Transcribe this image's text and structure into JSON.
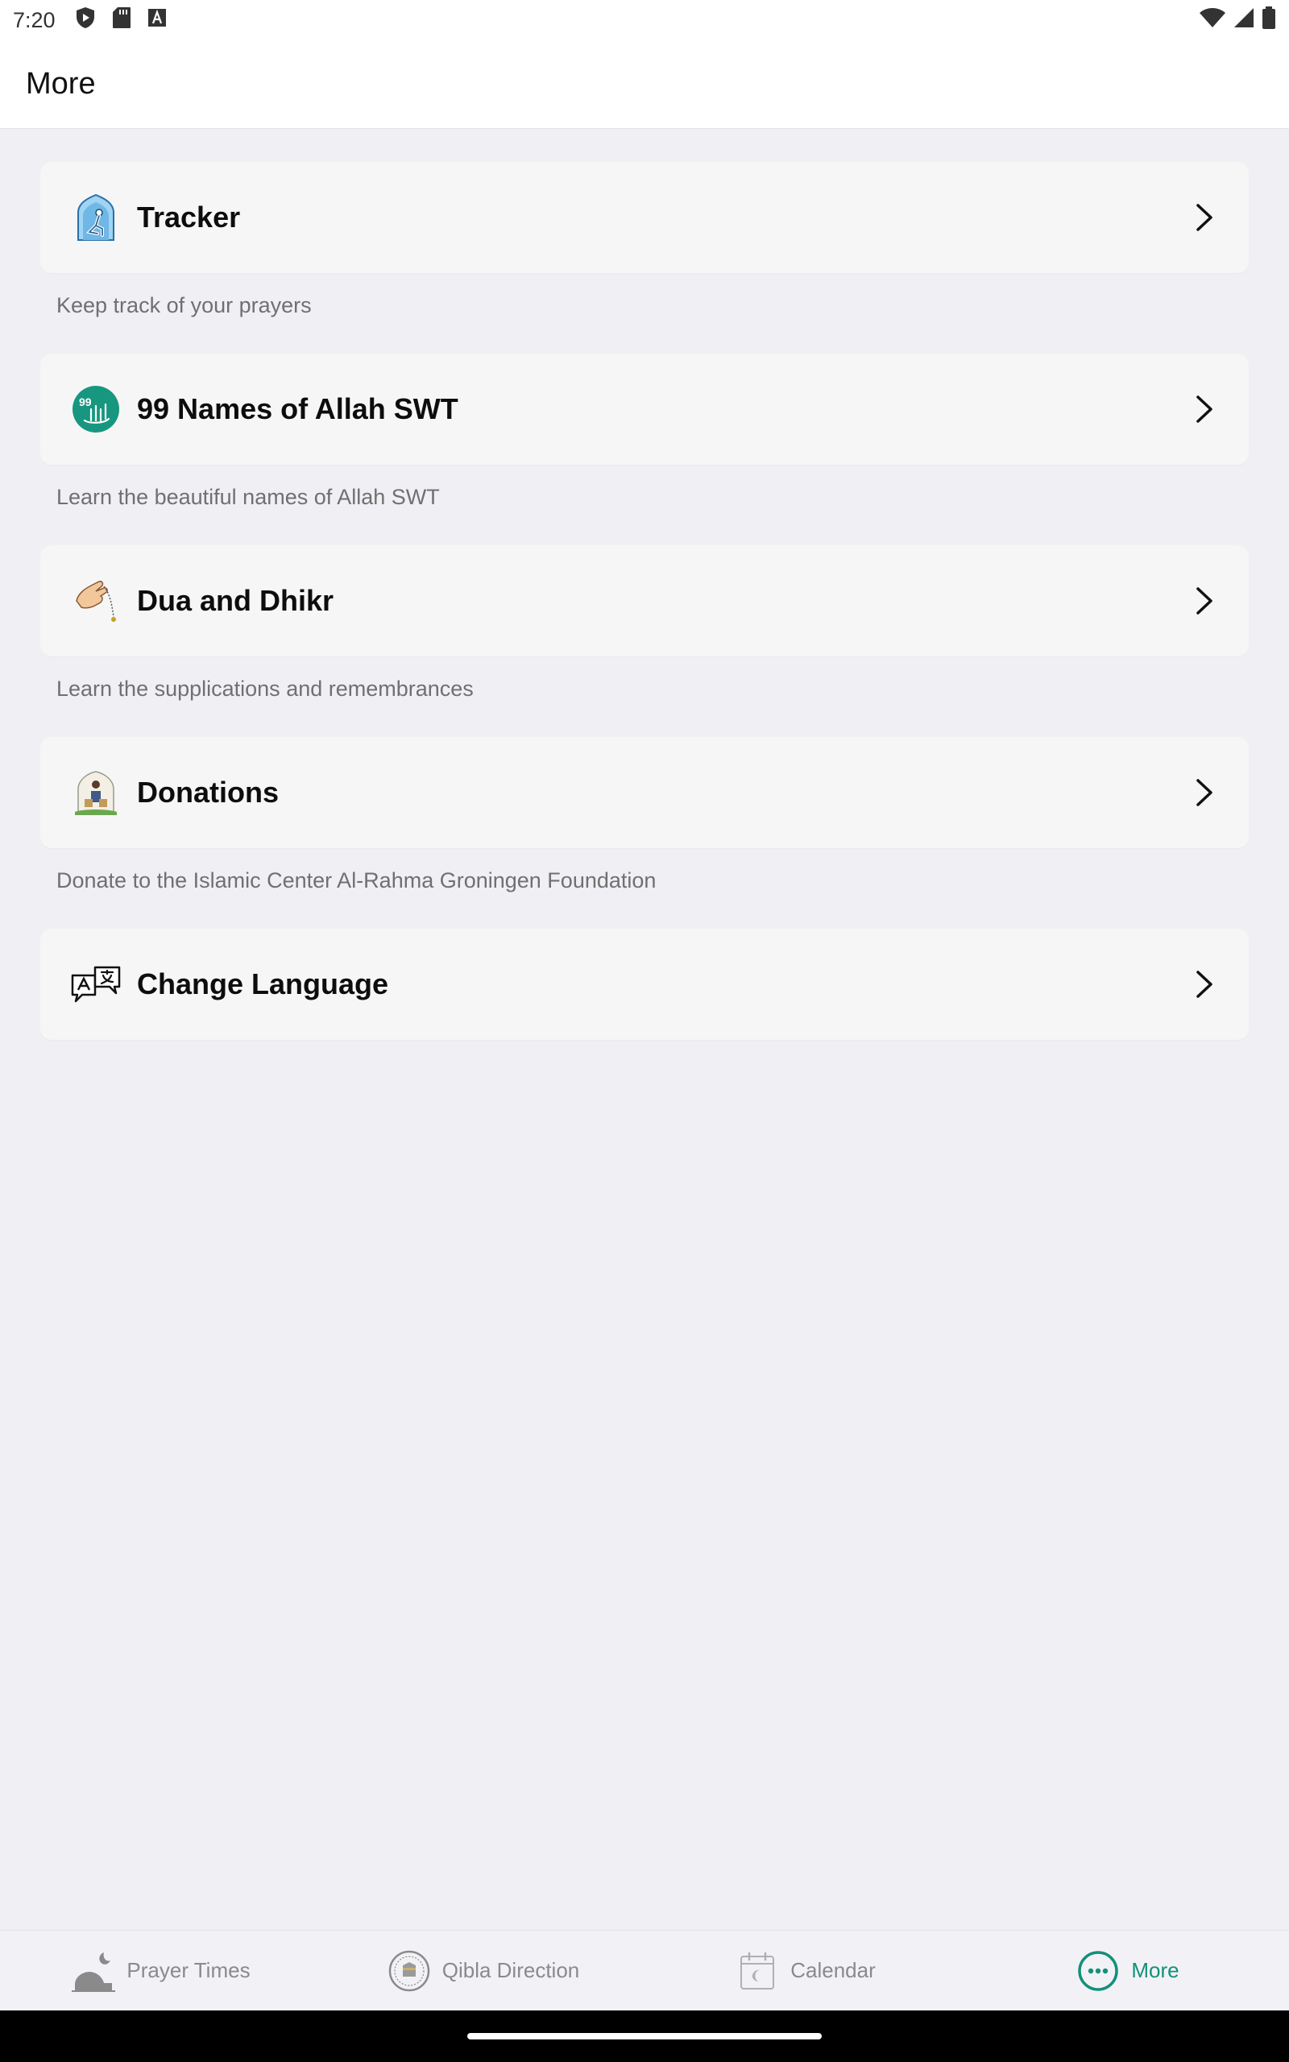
{
  "status_bar": {
    "time": "7:20",
    "left_icons": [
      "shield-play-icon",
      "sd-card-icon",
      "font-a-icon"
    ],
    "right_icons": [
      "wifi-icon",
      "cell-signal-icon",
      "battery-icon"
    ]
  },
  "app_bar": {
    "title": "More"
  },
  "menu": {
    "items": [
      {
        "label": "Tracker",
        "description": "Keep track of your prayers",
        "icon": "prayer-tracker-icon"
      },
      {
        "label": "99 Names of Allah SWT",
        "description": "Learn the beautiful names of Allah SWT",
        "icon": "names-of-allah-icon"
      },
      {
        "label": "Dua and Dhikr",
        "description": "Learn the supplications and remembrances",
        "icon": "dua-hands-icon"
      },
      {
        "label": "Donations",
        "description": "Donate to the Islamic Center Al-Rahma Groningen Foundation",
        "icon": "donations-icon"
      },
      {
        "label": "Change Language",
        "description": "",
        "icon": "translate-icon"
      }
    ]
  },
  "bottom_nav": {
    "items": [
      {
        "label": "Prayer Times",
        "icon": "mosque-moon-icon",
        "active": false
      },
      {
        "label": "Qibla Direction",
        "icon": "kaaba-compass-icon",
        "active": false
      },
      {
        "label": "Calendar",
        "icon": "calendar-icon",
        "active": false
      },
      {
        "label": "More",
        "icon": "more-dots-icon",
        "active": true
      }
    ]
  },
  "colors": {
    "accent": "#14907a",
    "background": "#f0f0f4",
    "card": "#f6f6f6",
    "inactive": "#8a8a8a"
  }
}
